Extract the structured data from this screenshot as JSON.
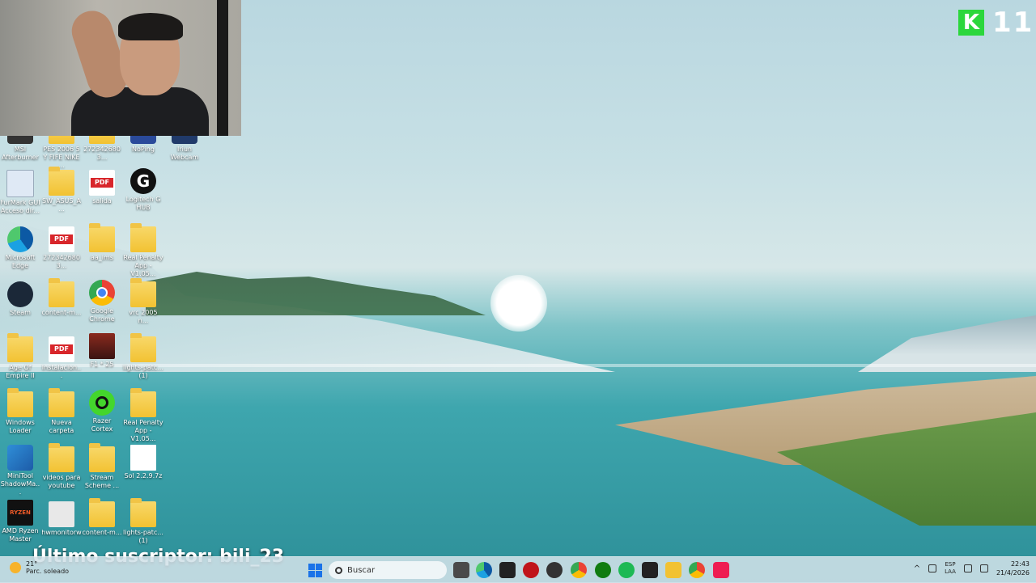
{
  "overlay": {
    "logo_letter": "K",
    "logo_number": "11",
    "subscriber_text": "Último suscriptor: bili_23"
  },
  "desktop": {
    "icons": [
      {
        "id": "afterburner",
        "label": "MSI Afterburner",
        "kind": "app"
      },
      {
        "id": "pes",
        "label": "PES 2006 5 Y FIFE NIKE ...",
        "kind": "folder"
      },
      {
        "id": "2723426803a",
        "label": "2723426803...",
        "kind": "folder"
      },
      {
        "id": "noping",
        "label": "NoPing",
        "kind": "app"
      },
      {
        "id": "webcam",
        "label": "Iriun Webcam",
        "kind": "app"
      },
      {
        "id": "furmark",
        "label": "FurMark GUI Acceso dir...",
        "kind": "app"
      },
      {
        "id": "swasus",
        "label": "SW_ASUS_A...",
        "kind": "folder"
      },
      {
        "id": "salida",
        "label": "salida",
        "kind": "pdf"
      },
      {
        "id": "logitech",
        "label": "Logitech G HUB",
        "kind": "app"
      },
      {
        "id": "edge",
        "label": "Microsoft Edge",
        "kind": "app"
      },
      {
        "id": "2723426803b",
        "label": "2723426803...",
        "kind": "pdf"
      },
      {
        "id": "aaims",
        "label": "aa_ims",
        "kind": "folder"
      },
      {
        "id": "realpenalty1",
        "label": "Real Penalty App - V1.05...",
        "kind": "folder"
      },
      {
        "id": "steam",
        "label": "Steam",
        "kind": "app"
      },
      {
        "id": "contentm1",
        "label": "content-m...",
        "kind": "folder"
      },
      {
        "id": "chrome",
        "label": "Google Chrome",
        "kind": "app"
      },
      {
        "id": "vrc",
        "label": "vrc 2005 n...",
        "kind": "folder"
      },
      {
        "id": "aoe",
        "label": "Age Of Empire II",
        "kind": "folder"
      },
      {
        "id": "instalacion",
        "label": "Instalacion...",
        "kind": "pdf"
      },
      {
        "id": "f125",
        "label": "F1 * 25",
        "kind": "game"
      },
      {
        "id": "lightspatch1",
        "label": "lights-patc... (1)",
        "kind": "folder"
      },
      {
        "id": "winloader",
        "label": "Windows Loader",
        "kind": "folder"
      },
      {
        "id": "nuevacarpeta",
        "label": "Nueva carpeta",
        "kind": "folder"
      },
      {
        "id": "razer",
        "label": "Razer Cortex",
        "kind": "app"
      },
      {
        "id": "realpenalty2",
        "label": "Real Penalty App - V1.05...",
        "kind": "folder"
      },
      {
        "id": "minitool",
        "label": "MiniTool ShadowMa...",
        "kind": "app"
      },
      {
        "id": "videos",
        "label": "videos para youtube",
        "kind": "folder"
      },
      {
        "id": "streamscheme",
        "label": "Stream Scheme ...",
        "kind": "folder"
      },
      {
        "id": "sol",
        "label": "Sol 2.2.9.7z",
        "kind": "file"
      },
      {
        "id": "ryzen",
        "label": "AMD Ryzen Master",
        "kind": "app"
      },
      {
        "id": "hwmonitor",
        "label": "hwmonitorw",
        "kind": "file"
      },
      {
        "id": "contentm2",
        "label": "content-m...",
        "kind": "folder"
      },
      {
        "id": "lightspatch2",
        "label": "lights-patc... (1)",
        "kind": "folder"
      }
    ]
  },
  "taskbar": {
    "weather_temp": "21°",
    "weather_desc": "Parc. soleado",
    "search_placeholder": "Buscar",
    "lang_top": "ESP",
    "lang_bottom": "LAA",
    "time": "22:43",
    "date": "21/4/2026",
    "accent_color": "#1a73e8"
  }
}
